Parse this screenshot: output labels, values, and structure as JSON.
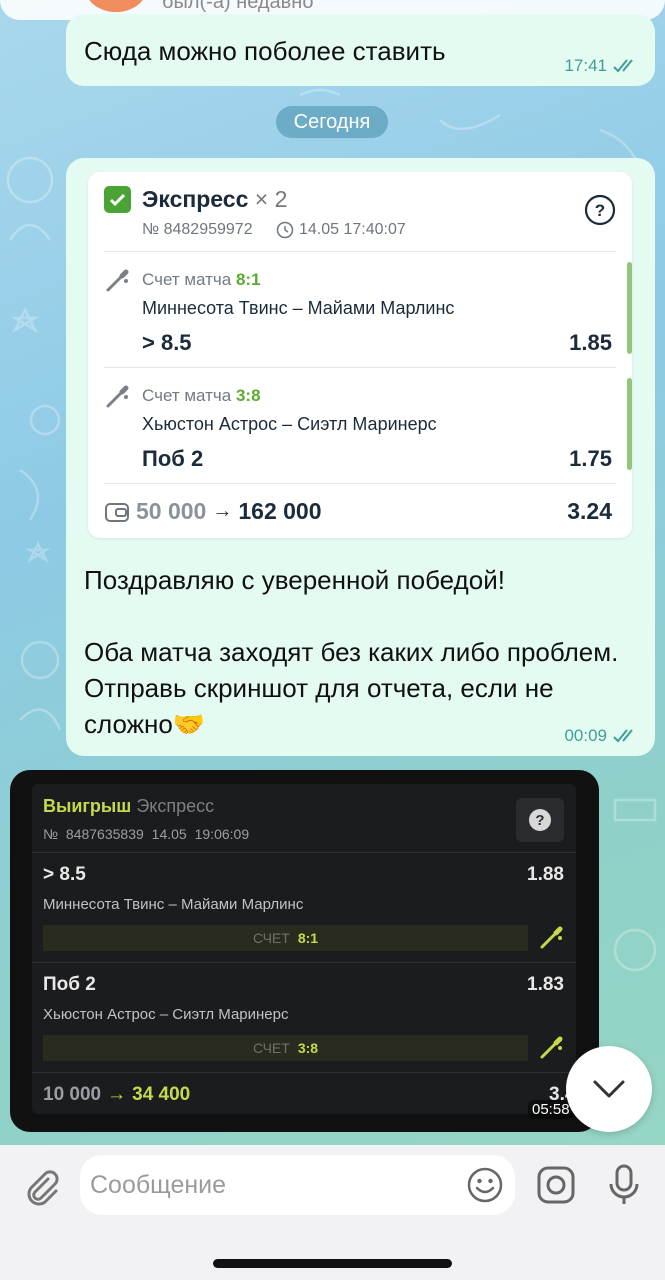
{
  "header": {
    "status": "был(-а) недавно"
  },
  "messages": {
    "m1": {
      "text": "Сюда можно поболее ставить",
      "time": "17:41"
    },
    "date_separator": "Сегодня",
    "m2": {
      "card": {
        "title": "Экспресс",
        "multiplier": "× 2",
        "number": "№ 8482959972",
        "datetime": "14.05 17:40:07",
        "legs": [
          {
            "score_label": "Счет матча",
            "score": "8:1",
            "teams": "Миннесота Твинс – Майами Марлинс",
            "bet": "> 8.5",
            "odd": "1.85"
          },
          {
            "score_label": "Счет матча",
            "score": "3:8",
            "teams": "Хьюстон Астрос – Сиэтл Маринерс",
            "bet": "Поб 2",
            "odd": "1.75"
          }
        ],
        "stake": "50 000",
        "arrow": "→",
        "payout": "162 000",
        "total_odd": "3.24"
      },
      "line1": "Поздравляю с уверенной победой!",
      "line2": "Оба матча заходят без каких либо проблем. Отправь скриншот для отчета, если не сложно🤝",
      "time": "00:09"
    },
    "m3": {
      "title_win": "Выигрыш",
      "title_type": "Экспресс",
      "number": "№ 8487635839",
      "date": "14.05",
      "time_detail": "19:06:09",
      "legs": [
        {
          "bet": "> 8.5",
          "odd": "1.88",
          "teams": "Миннесота Твинс – Майами Марлинс",
          "score_label": "СЧЕТ",
          "score": "8:1"
        },
        {
          "bet": "Поб 2",
          "odd": "1.83",
          "teams": "Хьюстон Астрос – Сиэтл Маринерс",
          "score_label": "СЧЕТ",
          "score": "3:8"
        }
      ],
      "stake": "10 000",
      "arrow": "→",
      "payout": "34 400",
      "total_odd": "3.44",
      "time": "05:58"
    }
  },
  "input": {
    "placeholder": "Сообщение"
  },
  "colors": {
    "bubble": "#e4fbf2",
    "accent": "#3f9e9a",
    "win": "#c6d94a",
    "check": "#4aa334"
  }
}
